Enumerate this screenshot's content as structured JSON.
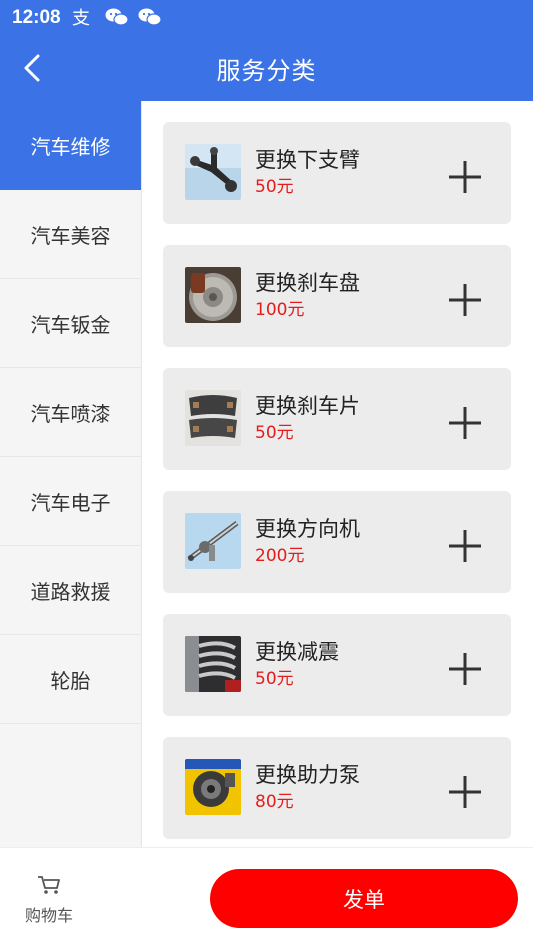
{
  "status_bar": {
    "time": "12:08",
    "icons": [
      "alipay-icon",
      "wechat-icon",
      "wechat-icon"
    ]
  },
  "header": {
    "title": "服务分类",
    "back_icon": "back-arrow-icon",
    "bg_color": "#3b73e6"
  },
  "sidebar": {
    "items": [
      {
        "label": "汽车维修",
        "active": true
      },
      {
        "label": "汽车美容",
        "active": false
      },
      {
        "label": "汽车钣金",
        "active": false
      },
      {
        "label": "汽车喷漆",
        "active": false
      },
      {
        "label": "汽车电子",
        "active": false
      },
      {
        "label": "道路救援",
        "active": false
      },
      {
        "label": "轮胎",
        "active": false
      }
    ]
  },
  "services": [
    {
      "name": "更换下支臂",
      "price": "50元",
      "icon": "control-arm-image"
    },
    {
      "name": "更换刹车盘",
      "price": "100元",
      "icon": "brake-disc-image"
    },
    {
      "name": "更换刹车片",
      "price": "50元",
      "icon": "brake-pads-image"
    },
    {
      "name": "更换方向机",
      "price": "200元",
      "icon": "steering-rack-image"
    },
    {
      "name": "更换减震",
      "price": "50元",
      "icon": "shock-absorber-image"
    },
    {
      "name": "更换助力泵",
      "price": "80元",
      "icon": "power-steering-pump-image"
    }
  ],
  "bottom_bar": {
    "cart_label": "购物车",
    "cart_icon": "cart-icon",
    "submit_label": "发单",
    "submit_color": "#fe0000"
  },
  "colors": {
    "accent": "#3b73e6",
    "price": "#e51c1c",
    "card_bg": "#ececec"
  }
}
